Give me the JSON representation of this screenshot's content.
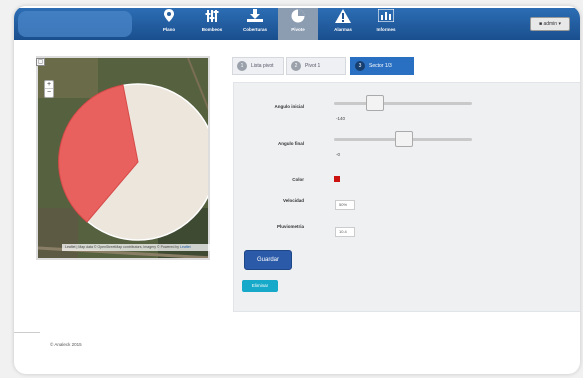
{
  "navbar": {
    "items": [
      {
        "label": "Plano",
        "icon": "map-marker-icon"
      },
      {
        "label": "Bombeos",
        "icon": "sliders-icon"
      },
      {
        "label": "Coberturas",
        "icon": "download-tray-icon"
      },
      {
        "label": "Pivote",
        "icon": "pie-chart-icon",
        "active": true
      },
      {
        "label": "Alarmas",
        "icon": "warning-icon"
      },
      {
        "label": "Informes",
        "icon": "bar-chart-icon"
      }
    ],
    "user_menu": "admin"
  },
  "map": {
    "zoom_in": "+",
    "zoom_out": "−",
    "attribution_left": "Leaflet | Map data © OpenStreetMap contributors, Imagery ©",
    "attribution_right": "Leaflet",
    "attribution_prefix": "Powered by",
    "sector_color": "#e8615f",
    "circle_color": "#ece6dd"
  },
  "steps": [
    {
      "num": "1",
      "label": "Lista pivot"
    },
    {
      "num": "2",
      "label": "Pivot 1"
    },
    {
      "num": "3",
      "label": "Sector 1/3",
      "active": true
    }
  ],
  "form": {
    "angle_start_label": "Angulo inicial",
    "angle_start_value": "-140",
    "angle_start_fraction": 0.33,
    "angle_end_label": "Angulo final",
    "angle_end_value": "-0",
    "angle_end_fraction": 0.54,
    "color_label": "Color",
    "color_value": "#cc1111",
    "speed_label": "Velocidad",
    "speed_value": "50%",
    "rain_label": "Pluviometria",
    "rain_value": "10.4",
    "save_label": "Guardar",
    "delete_label": "Eliminar"
  },
  "footer": {
    "text": "© Analeck 2015"
  }
}
